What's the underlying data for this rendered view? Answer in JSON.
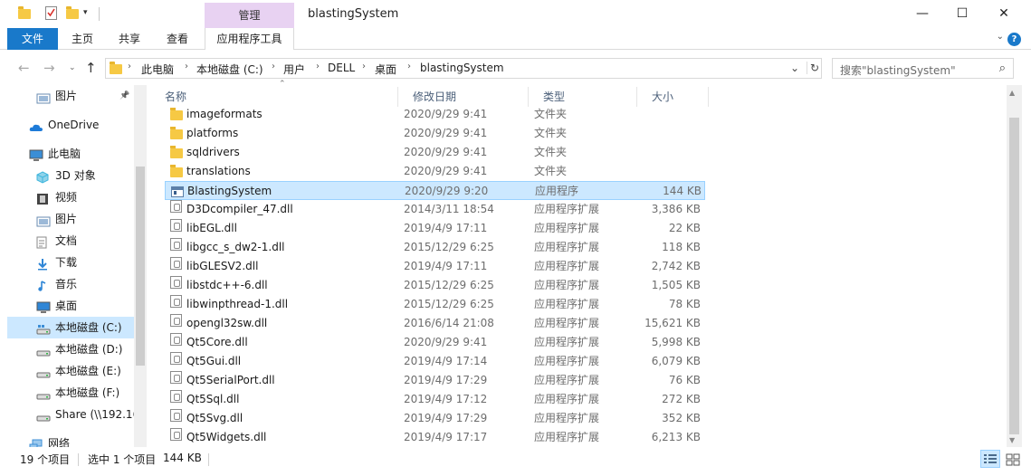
{
  "window": {
    "title": "blastingSystem",
    "manage_tab": "管理",
    "minimize": "—",
    "maximize": "☐",
    "close": "✕"
  },
  "ribbon": {
    "tabs": [
      "文件",
      "主页",
      "共享",
      "查看",
      "应用程序工具"
    ],
    "file_color": "#1979ca",
    "manage_color": "#e8d2f2"
  },
  "address": {
    "crumbs": [
      "此电脑",
      "本地磁盘 (C:)",
      "用户",
      "DELL",
      "桌面",
      "blastingSystem"
    ],
    "refresh": "↻",
    "dropdown": "⌄"
  },
  "search": {
    "placeholder": "搜索\"blastingSystem\""
  },
  "sidebar": {
    "items": [
      {
        "label": "图片",
        "icon": "pictures-icon"
      },
      {
        "label": "OneDrive",
        "icon": "onedrive-icon"
      },
      {
        "label": "此电脑",
        "icon": "this-pc-icon"
      },
      {
        "label": "3D 对象",
        "icon": "3d-objects-icon"
      },
      {
        "label": "视频",
        "icon": "videos-icon"
      },
      {
        "label": "图片",
        "icon": "pictures-icon"
      },
      {
        "label": "文档",
        "icon": "documents-icon"
      },
      {
        "label": "下载",
        "icon": "downloads-icon"
      },
      {
        "label": "音乐",
        "icon": "music-icon"
      },
      {
        "label": "桌面",
        "icon": "desktop-icon"
      },
      {
        "label": "本地磁盘 (C:)",
        "icon": "drive-c-icon"
      },
      {
        "label": "本地磁盘 (D:)",
        "icon": "drive-icon"
      },
      {
        "label": "本地磁盘 (E:)",
        "icon": "drive-icon"
      },
      {
        "label": "本地磁盘 (F:)",
        "icon": "drive-icon"
      },
      {
        "label": "Share (\\\\192.16",
        "icon": "network-drive-icon"
      },
      {
        "label": "网络",
        "icon": "network-icon"
      }
    ],
    "selected_index": 10
  },
  "columns": {
    "name": "名称",
    "date": "修改日期",
    "type": "类型",
    "size": "大小"
  },
  "files": [
    {
      "name": "imageformats",
      "date": "2020/9/29 9:41",
      "type": "文件夹",
      "size": "",
      "kind": "folder"
    },
    {
      "name": "platforms",
      "date": "2020/9/29 9:41",
      "type": "文件夹",
      "size": "",
      "kind": "folder"
    },
    {
      "name": "sqldrivers",
      "date": "2020/9/29 9:41",
      "type": "文件夹",
      "size": "",
      "kind": "folder"
    },
    {
      "name": "translations",
      "date": "2020/9/29 9:41",
      "type": "文件夹",
      "size": "",
      "kind": "folder"
    },
    {
      "name": "BlastingSystem",
      "date": "2020/9/29 9:20",
      "type": "应用程序",
      "size": "144 KB",
      "kind": "exe"
    },
    {
      "name": "D3Dcompiler_47.dll",
      "date": "2014/3/11 18:54",
      "type": "应用程序扩展",
      "size": "3,386 KB",
      "kind": "dll"
    },
    {
      "name": "libEGL.dll",
      "date": "2019/4/9 17:11",
      "type": "应用程序扩展",
      "size": "22 KB",
      "kind": "dll"
    },
    {
      "name": "libgcc_s_dw2-1.dll",
      "date": "2015/12/29 6:25",
      "type": "应用程序扩展",
      "size": "118 KB",
      "kind": "dll"
    },
    {
      "name": "libGLESV2.dll",
      "date": "2019/4/9 17:11",
      "type": "应用程序扩展",
      "size": "2,742 KB",
      "kind": "dll"
    },
    {
      "name": "libstdc++-6.dll",
      "date": "2015/12/29 6:25",
      "type": "应用程序扩展",
      "size": "1,505 KB",
      "kind": "dll"
    },
    {
      "name": "libwinpthread-1.dll",
      "date": "2015/12/29 6:25",
      "type": "应用程序扩展",
      "size": "78 KB",
      "kind": "dll"
    },
    {
      "name": "opengl32sw.dll",
      "date": "2016/6/14 21:08",
      "type": "应用程序扩展",
      "size": "15,621 KB",
      "kind": "dll"
    },
    {
      "name": "Qt5Core.dll",
      "date": "2020/9/29 9:41",
      "type": "应用程序扩展",
      "size": "5,998 KB",
      "kind": "dll"
    },
    {
      "name": "Qt5Gui.dll",
      "date": "2019/4/9 17:14",
      "type": "应用程序扩展",
      "size": "6,079 KB",
      "kind": "dll"
    },
    {
      "name": "Qt5SerialPort.dll",
      "date": "2019/4/9 17:29",
      "type": "应用程序扩展",
      "size": "76 KB",
      "kind": "dll"
    },
    {
      "name": "Qt5Sql.dll",
      "date": "2019/4/9 17:12",
      "type": "应用程序扩展",
      "size": "272 KB",
      "kind": "dll"
    },
    {
      "name": "Qt5Svg.dll",
      "date": "2019/4/9 17:29",
      "type": "应用程序扩展",
      "size": "352 KB",
      "kind": "dll"
    },
    {
      "name": "Qt5Widgets.dll",
      "date": "2019/4/9 17:17",
      "type": "应用程序扩展",
      "size": "6,213 KB",
      "kind": "dll"
    }
  ],
  "selected_file_index": 4,
  "status": {
    "count": "19 个项目",
    "selection": "选中 1 个项目",
    "size": "144 KB"
  }
}
